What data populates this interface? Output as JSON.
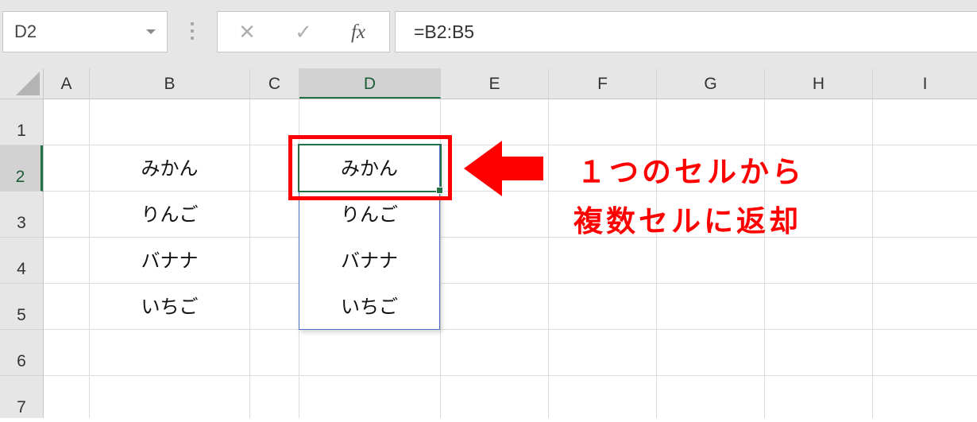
{
  "name_box": {
    "value": "D2"
  },
  "formula_bar": {
    "cancel_glyph": "✕",
    "confirm_glyph": "✓",
    "fx_label": "fx",
    "formula": "=B2:B5"
  },
  "columns": [
    "A",
    "B",
    "C",
    "D",
    "E",
    "F",
    "G",
    "H",
    "I"
  ],
  "selected_column": "D",
  "rows": [
    "1",
    "2",
    "3",
    "4",
    "5",
    "6",
    "7"
  ],
  "selected_row": "2",
  "cells": {
    "B2": "みかん",
    "B3": "りんご",
    "B4": "バナナ",
    "B5": "いちご",
    "D2": "みかん",
    "D3": "りんご",
    "D4": "バナナ",
    "D5": "いちご"
  },
  "annotation": {
    "line1": "１つのセルから",
    "line2": "複数セルに返却",
    "color": "#ff0000"
  },
  "colors": {
    "accent_green": "#217346",
    "spill_border": "#4a6fc4",
    "header_bg": "#e6e6e6"
  }
}
